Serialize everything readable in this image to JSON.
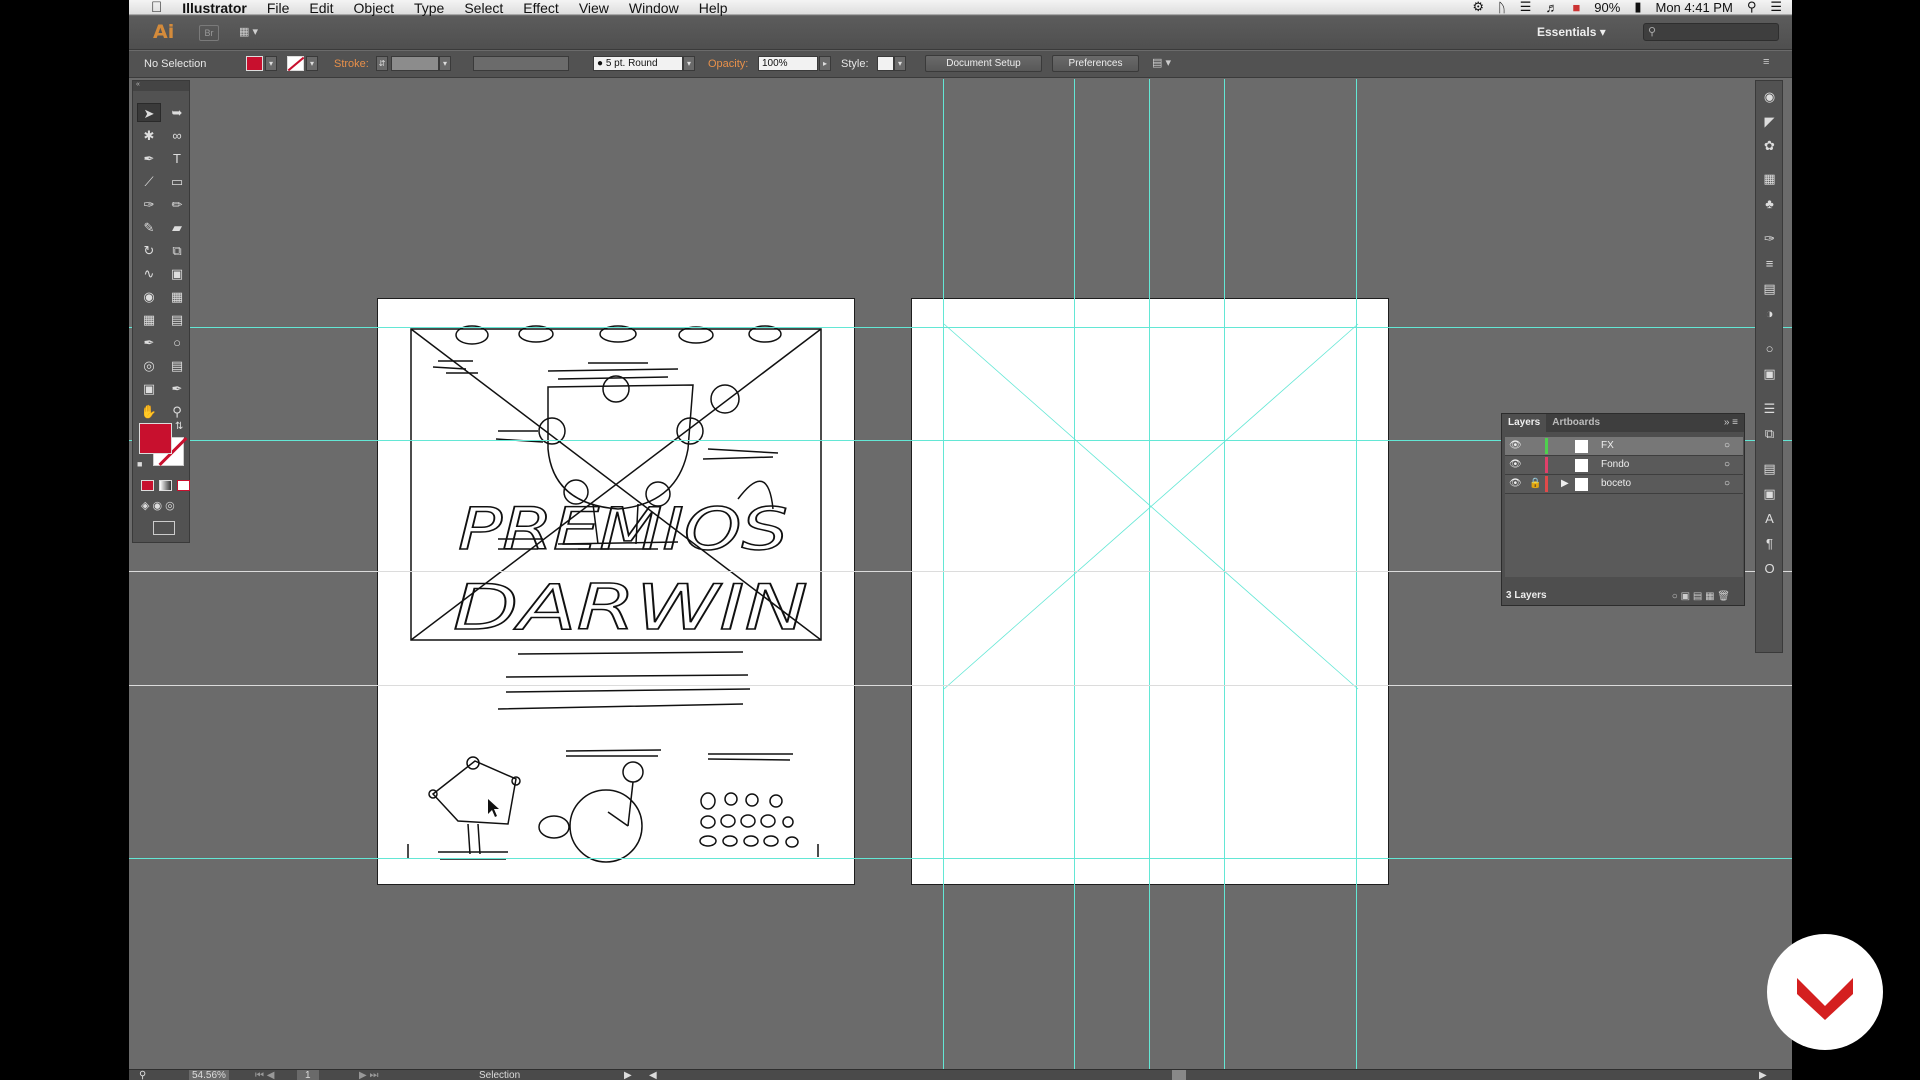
{
  "menubar": {
    "app_name": "Illustrator",
    "menus": [
      "File",
      "Edit",
      "Object",
      "Type",
      "Select",
      "Effect",
      "View",
      "Window",
      "Help"
    ],
    "battery": "90%",
    "clock": "Mon 4:41 PM"
  },
  "appbar": {
    "logo": "Ai",
    "bridge": "Br",
    "workspace": "Essentials"
  },
  "controlbar": {
    "selection": "No Selection",
    "stroke_label": "Stroke:",
    "brush": "5 pt. Round",
    "opacity_label": "Opacity:",
    "opacity_value": "100%",
    "style_label": "Style:",
    "document_setup": "Document Setup",
    "preferences": "Preferences"
  },
  "colors": {
    "fill": "#c8102e",
    "guide": "#63e7d5",
    "panel": "#525252",
    "pasteboard": "#6b6b6b"
  },
  "tools": [
    "selection-tool",
    "direct-selection-tool",
    "magic-wand-tool",
    "lasso-tool",
    "pen-tool",
    "type-tool",
    "line-tool",
    "rectangle-tool",
    "paintbrush-tool",
    "pencil-tool",
    "blob-brush-tool",
    "eraser-tool",
    "rotate-tool",
    "scale-tool",
    "width-tool",
    "free-transform-tool",
    "shape-builder-tool",
    "perspective-grid-tool",
    "mesh-tool",
    "gradient-tool",
    "eyedropper-tool",
    "blend-tool",
    "symbol-sprayer-tool",
    "column-graph-tool",
    "artboard-tool",
    "slice-tool",
    "hand-tool",
    "zoom-tool"
  ],
  "sketch": {
    "title_line1": "PREMIOS",
    "title_line2": "DARWIN"
  },
  "layers_panel": {
    "tabs": [
      "Layers",
      "Artboards"
    ],
    "layers": [
      {
        "name": "FX",
        "color": "#4ed04e"
      },
      {
        "name": "Fondo",
        "color": "#e0406a"
      },
      {
        "name": "boceto",
        "color": "#e04a4a"
      }
    ],
    "footer": "3 Layers"
  },
  "statusbar": {
    "zoom": "54.56%",
    "artboard_num": "1",
    "tool": "Selection"
  }
}
